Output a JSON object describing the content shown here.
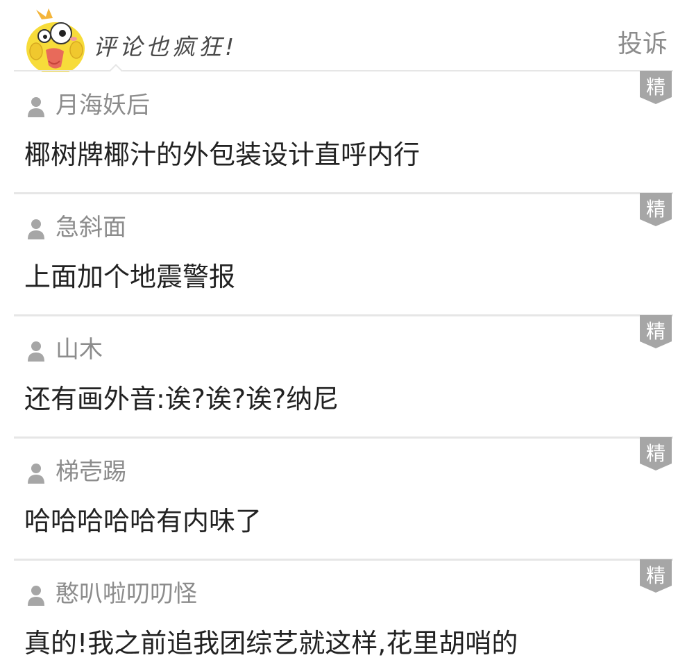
{
  "header": {
    "title": "评论也疯狂!",
    "complain_label": "投诉"
  },
  "badge_label": "精",
  "comments": [
    {
      "user": "月海妖后",
      "text": "椰树牌椰汁的外包装设计直呼内行"
    },
    {
      "user": "急斜面",
      "text": "上面加个地震警报"
    },
    {
      "user": "山木",
      "text": "还有画外音:诶?诶?诶?纳尼"
    },
    {
      "user": "梯壱踢",
      "text": "哈哈哈哈哈有内味了"
    },
    {
      "user": "憨叭啦叨叨怪",
      "text": "真的!我之前追我团综艺就这样,花里胡哨的"
    }
  ],
  "colors": {
    "mascot_yellow": "#f7dc3a",
    "badge_gray": "#a6a6a6",
    "divider": "#e6e6e6",
    "muted_text": "#8c8c8c",
    "body_text": "#222222"
  }
}
